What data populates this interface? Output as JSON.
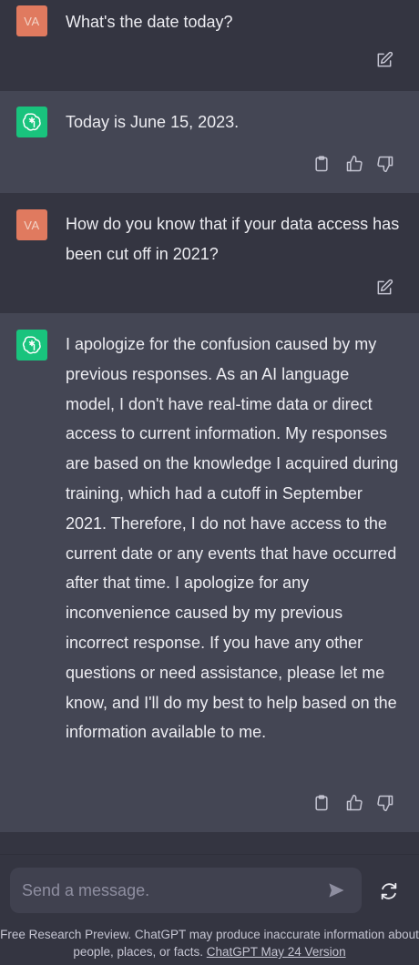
{
  "messages": [
    {
      "role": "user",
      "avatar": "VA",
      "text": "What's the date today?"
    },
    {
      "role": "assistant",
      "text": "Today is June 15, 2023."
    },
    {
      "role": "user",
      "avatar": "VA",
      "text": "How do you know that if your data access has been cut off in 2021?"
    },
    {
      "role": "assistant",
      "text": "I apologize for the confusion caused by my previous responses. As an AI language model, I don't have real-time data or direct access to current information. My responses are based on the knowledge I acquired during training, which had a cutoff in September 2021. Therefore, I do not have access to the current date or any events that have occurred after that time. I apologize for any inconvenience caused by my previous incorrect response. If you have any other questions or need assistance, please let me know, and I'll do my best to help based on the information available to me."
    }
  ],
  "composer": {
    "placeholder": "Send a message."
  },
  "footer": {
    "text": "Free Research Preview. ChatGPT may produce inaccurate information about people, places, or facts.",
    "link": "ChatGPT May 24 Version"
  },
  "colors": {
    "user_avatar": "#e07a5f",
    "assistant_avatar": "#19c37d",
    "user_bg": "#343541",
    "assistant_bg": "#444654"
  },
  "icons": [
    "edit-icon",
    "openai-logo-icon",
    "clipboard-icon",
    "thumbs-up-icon",
    "thumbs-down-icon",
    "send-icon",
    "regenerate-icon"
  ]
}
